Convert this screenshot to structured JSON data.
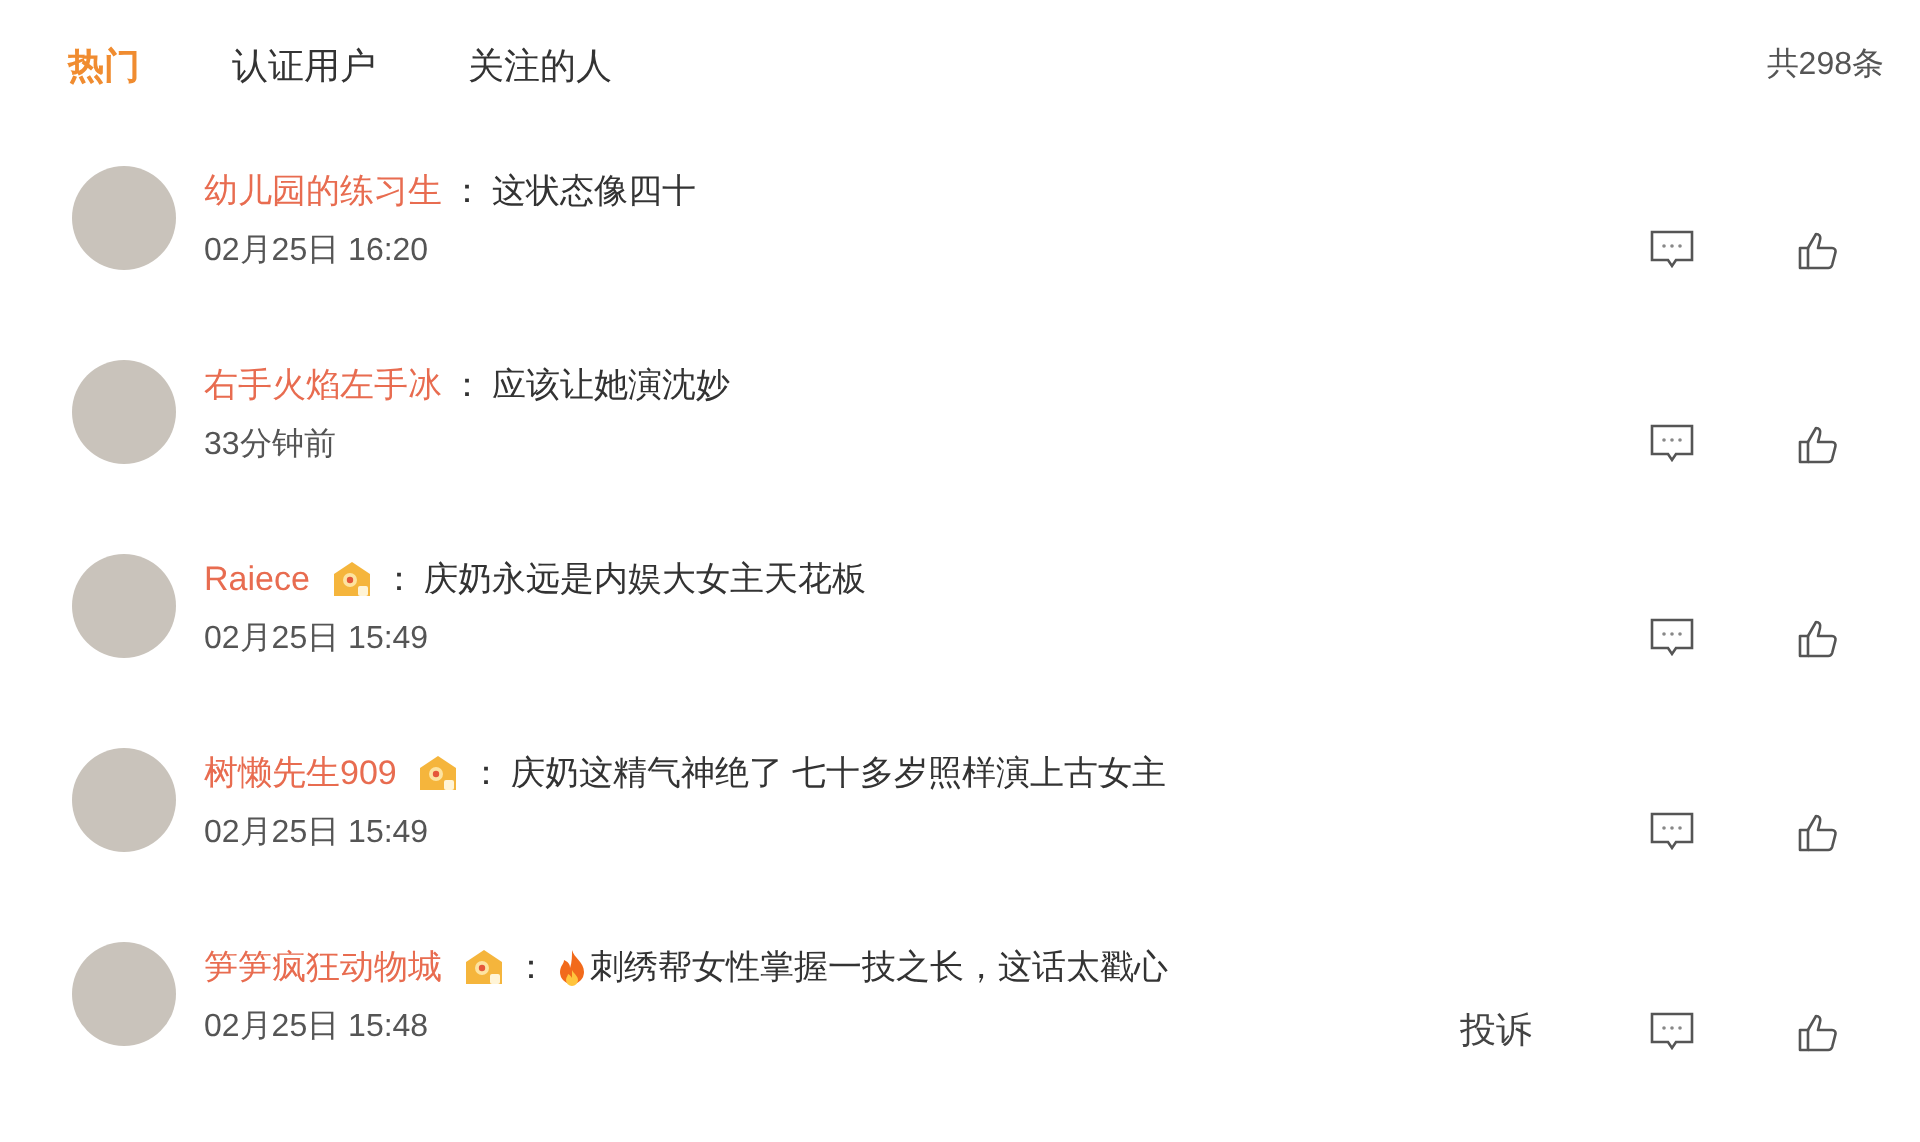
{
  "tabs": [
    {
      "label": "热门",
      "selected": true
    },
    {
      "label": "认证用户",
      "selected": false
    },
    {
      "label": "关注的人",
      "selected": false
    }
  ],
  "total": "共298条",
  "comments": [
    {
      "user": "幼儿园的练习生",
      "badge": false,
      "fire": false,
      "text": "这状态像四十",
      "time": "02月25日 16:20"
    },
    {
      "user": "右手火焰左手冰",
      "badge": false,
      "fire": false,
      "text": "应该让她演沈妙",
      "time": "33分钟前"
    },
    {
      "user": "Raiece",
      "badge": true,
      "fire": false,
      "text": "庆奶永远是内娱大女主天花板",
      "time": "02月25日 15:49"
    },
    {
      "user": "树懒先生909",
      "badge": true,
      "fire": false,
      "text": "庆奶这精气神绝了 七十多岁照样演上古女主",
      "time": "02月25日 15:49"
    },
    {
      "user": "笋笋疯狂动物城",
      "badge": true,
      "fire": true,
      "text": "刺绣帮女性掌握一技之长，这话太戳心",
      "time": "02月25日 15:48",
      "report": "投诉"
    }
  ],
  "separator": "："
}
